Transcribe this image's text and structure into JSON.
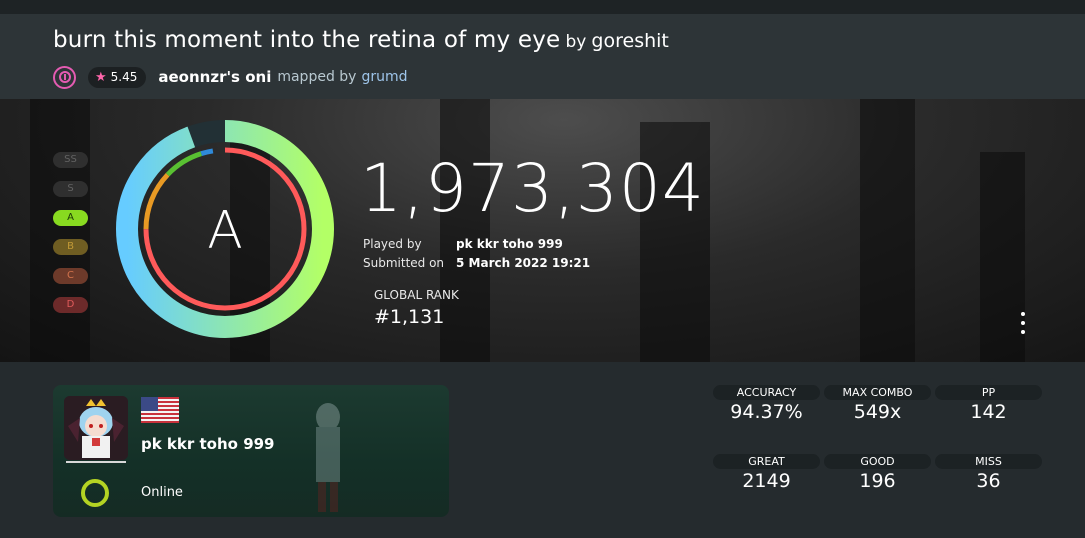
{
  "beatmap": {
    "title": "burn this moment into the retina of my eye",
    "by_label": "by",
    "artist": "goreshit",
    "mode_icon": "taiko-mode-icon",
    "star_rating": "5.45",
    "difficulty": "aeonnzr's oni",
    "mapped_by_label": "mapped by",
    "mapper": "grumd"
  },
  "grades": [
    "SS",
    "S",
    "A",
    "B",
    "C",
    "D"
  ],
  "current_grade": "A",
  "accuracy_fraction": 0.9437,
  "score": "1,973,304",
  "played_by_label": "Played by",
  "played_by": "pk kkr toho 999",
  "submitted_label": "Submitted on",
  "submitted_on": "5 March 2022 19:21",
  "global_rank_label": "GLOBAL RANK",
  "global_rank": "#1,131",
  "player": {
    "username": "pk kkr toho 999",
    "flag": "us-flag-icon",
    "status": "Online",
    "status_color": "#b4d323"
  },
  "stats": {
    "accuracy_label": "ACCURACY",
    "accuracy": "94.37%",
    "max_combo_label": "MAX COMBO",
    "max_combo": "549x",
    "pp_label": "PP",
    "pp": "142",
    "great_label": "GREAT",
    "great": "2149",
    "good_label": "GOOD",
    "good": "196",
    "miss_label": "MISS",
    "miss": "36"
  },
  "colors": {
    "mode_pink": "#e45bb2",
    "grade_a": "#88da20",
    "ring_outer_start": "#66ccff",
    "ring_outer_end": "#b3ff66",
    "ring_inner_main": "#ff5a5a"
  }
}
